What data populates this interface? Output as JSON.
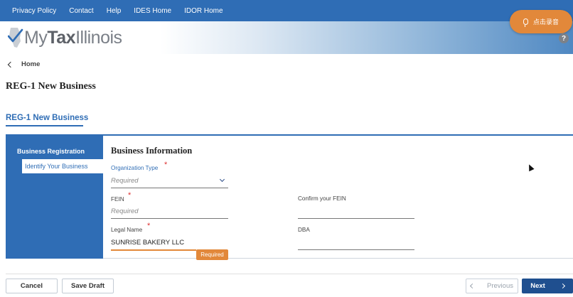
{
  "topnav": {
    "links": [
      "Privacy Policy",
      "Contact",
      "Help",
      "IDES Home",
      "IDOR Home"
    ]
  },
  "record_button": {
    "label": "点击录音",
    "icon": "microphone-icon"
  },
  "logo": {
    "prefix": "My",
    "suffix": "Tax",
    "state": "Illinois"
  },
  "help": {
    "label": "?"
  },
  "breadcrumb": {
    "home": "Home"
  },
  "page": {
    "title": "REG-1 New Business"
  },
  "section": {
    "title": "REG-1 New Business"
  },
  "sidebar": {
    "group": "Business Registration",
    "active_item": "Identify Your Business"
  },
  "form": {
    "title": "Business Information",
    "organization_type": {
      "label": "Organization Type",
      "star": "*",
      "placeholder": "Required"
    },
    "fein": {
      "label": "FEIN",
      "star": "*",
      "placeholder": "Required"
    },
    "confirm_fein": {
      "label": "Confirm your FEIN",
      "value": ""
    },
    "legal_name": {
      "label": "Legal Name",
      "star": "*",
      "value": "SUNRISE BAKERY LLC",
      "error_badge": "Required"
    },
    "dba": {
      "label": "DBA",
      "value": ""
    }
  },
  "actions": {
    "cancel": "Cancel",
    "save_draft": "Save Draft",
    "previous": "Previous",
    "next": "Next"
  },
  "colors": {
    "primary_blue": "#2f6db5",
    "navy": "#1f4f8f",
    "accent_orange": "#e2883a",
    "required_red": "#dd3333"
  }
}
